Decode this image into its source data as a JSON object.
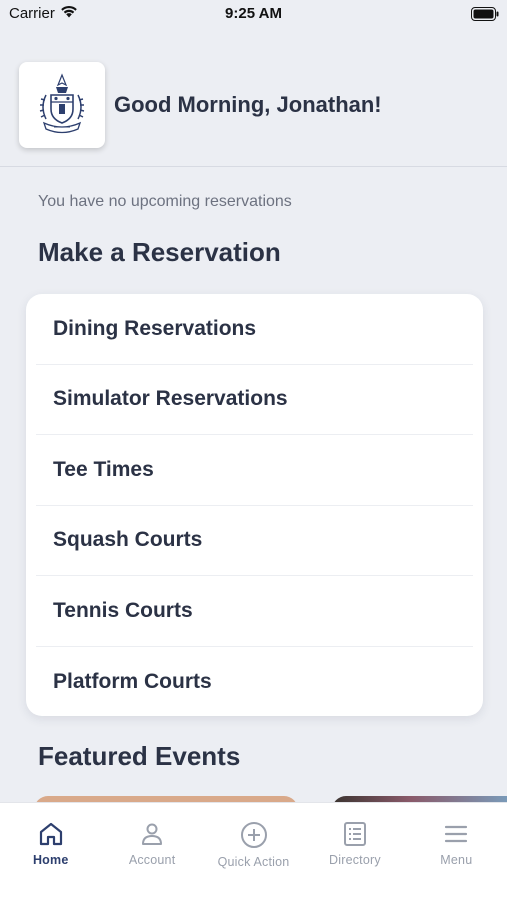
{
  "status_bar": {
    "carrier": "Carrier",
    "time": "9:25 AM"
  },
  "header": {
    "greeting": "Good Morning, Jonathan!"
  },
  "upcoming": {
    "message": "You have no upcoming reservations"
  },
  "reservations": {
    "title": "Make a Reservation",
    "items": [
      {
        "label": "Dining Reservations"
      },
      {
        "label": "Simulator Reservations"
      },
      {
        "label": "Tee Times"
      },
      {
        "label": "Squash Courts"
      },
      {
        "label": "Tennis Courts"
      },
      {
        "label": "Platform Courts"
      }
    ]
  },
  "events": {
    "title": "Featured Events"
  },
  "tab_bar": {
    "active": "Home",
    "tabs": [
      {
        "label": "Home",
        "icon": "home-icon"
      },
      {
        "label": "Account",
        "icon": "account-icon"
      },
      {
        "label": "Quick Action",
        "icon": "plus-circle-icon"
      },
      {
        "label": "Directory",
        "icon": "directory-icon"
      },
      {
        "label": "Menu",
        "icon": "menu-icon"
      }
    ]
  },
  "colors": {
    "background": "#eceef3",
    "text_primary": "#2b3245",
    "tab_active": "#2d3f6e",
    "tab_inactive": "#9aa0ac"
  }
}
